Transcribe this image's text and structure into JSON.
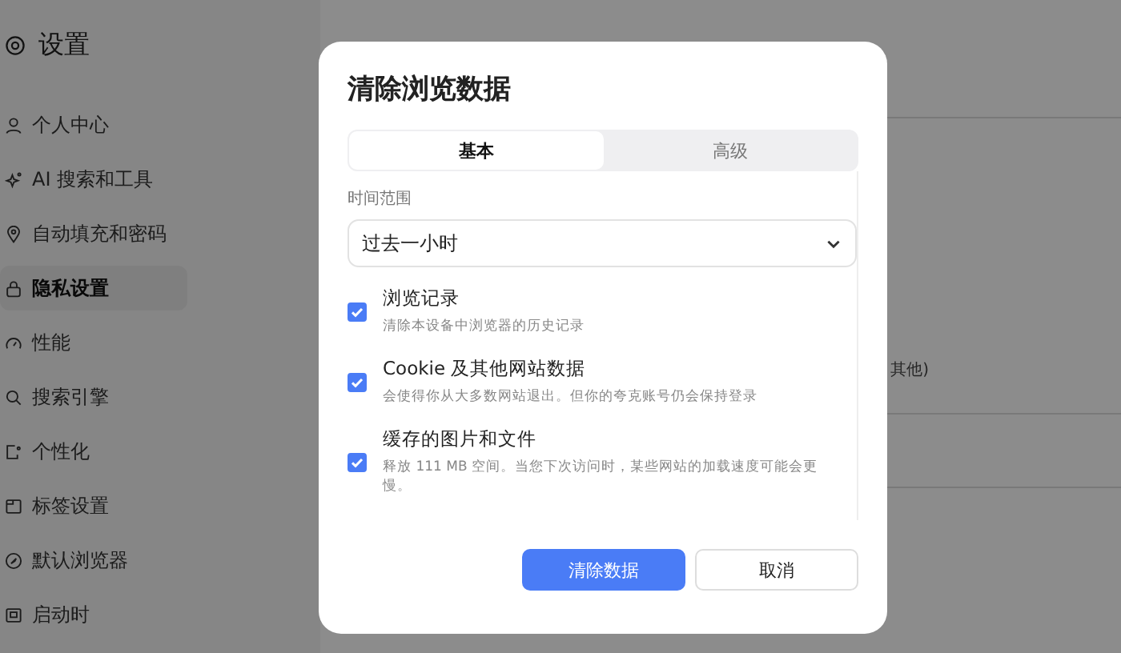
{
  "sidebar": {
    "title": "设置",
    "items": [
      {
        "label": "个人中心",
        "selected": false
      },
      {
        "label": "AI 搜索和工具",
        "selected": false
      },
      {
        "label": "自动填充和密码",
        "selected": false
      },
      {
        "label": "隐私设置",
        "selected": true
      },
      {
        "label": "性能",
        "selected": false
      },
      {
        "label": "搜索引擎",
        "selected": false
      },
      {
        "label": "个性化",
        "selected": false
      },
      {
        "label": "标签设置",
        "selected": false
      },
      {
        "label": "默认浏览器",
        "selected": false
      },
      {
        "label": "启动时",
        "selected": false
      }
    ]
  },
  "page": {
    "fragment": "其他)"
  },
  "dialog": {
    "title": "清除浏览数据",
    "tabs": [
      {
        "label": "基本",
        "selected": true
      },
      {
        "label": "高级",
        "selected": false
      }
    ],
    "time_range": {
      "label": "时间范围",
      "value": "过去一小时"
    },
    "options": [
      {
        "title": "浏览记录",
        "description": "清除本设备中浏览器的历史记录",
        "checked": true
      },
      {
        "title": "Cookie 及其他网站数据",
        "description": "会使得你从大多数网站退出。但你的夸克账号仍会保持登录",
        "checked": true
      },
      {
        "title": "缓存的图片和文件",
        "description": "释放 111 MB 空间。当您下次访问时，某些网站的加载速度可能会更慢。",
        "checked": true
      }
    ],
    "buttons": [
      {
        "label": "清除数据",
        "kind": "primary"
      },
      {
        "label": "取消",
        "kind": "secondary"
      }
    ]
  }
}
